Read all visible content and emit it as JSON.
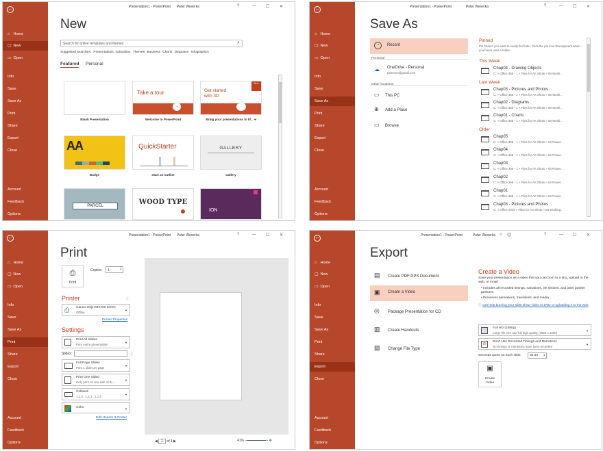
{
  "titlebar": {
    "doc": "Presentation1 - PowerPoint",
    "user": "Peter Weverka",
    "help": "?",
    "min": "—",
    "max": "☐",
    "close": "✕"
  },
  "sidebar": {
    "back": "←",
    "home": "Home",
    "new": "New",
    "open": "Open",
    "info": "Info",
    "save": "Save",
    "saveas": "Save As",
    "print": "Print",
    "share": "Share",
    "export": "Export",
    "close": "Close",
    "account": "Account",
    "feedback": "Feedback",
    "options": "Options"
  },
  "new_panel": {
    "title": "New",
    "search_placeholder": "Search for online templates and themes",
    "suggested": "Suggested searches:",
    "sugg": [
      "Presentations",
      "Education",
      "Themes",
      "Business",
      "Charts",
      "Diagrams",
      "Infographics"
    ],
    "tab_featured": "Featured",
    "tab_personal": "Personal",
    "templates": [
      {
        "name": "Blank Presentation",
        "art": ""
      },
      {
        "name": "Welcome to PowerPoint",
        "art": "Take a tour"
      },
      {
        "name": "Bring your presentations to lif...",
        "art": "Get started with 3D",
        "ribbon": "New"
      },
      {
        "name": "Badge",
        "art": "AA"
      },
      {
        "name": "Start an outline",
        "art": "QuickStarter"
      },
      {
        "name": "Gallery",
        "art": "GALLERY"
      },
      {
        "name": "",
        "art": "PARCEL"
      },
      {
        "name": "",
        "art": "WOOD TYPE"
      },
      {
        "name": "",
        "art": "ION"
      }
    ]
  },
  "saveas_panel": {
    "title": "Save As",
    "recent": "Recent",
    "personal": "Personal",
    "onedrive": "OneDrive - Personal",
    "onedrive_email": "petervev@gmail.com",
    "other": "Other locations",
    "thispc": "This PC",
    "addplace": "Add a Place",
    "browse": "Browse",
    "pinned": "Pinned",
    "pinned_desc": "Pin folders you want to easily find later. Click the pin icon that appears when you hover over a folder.",
    "groups": [
      {
        "label": "This Week",
        "items": [
          {
            "n": "Chap04 - Drawing Objects",
            "p": "C: » Office 365 - 1 » Files for Art Shots » 08 Worki..."
          }
        ]
      },
      {
        "label": "Last Week",
        "items": [
          {
            "n": "Chap03 - Pictures and Photos",
            "p": "C: » Office 365 - 1 » Files for Art Shots » 08 Worki..."
          },
          {
            "n": "Chap02 - Diagrams",
            "p": "C: » Office 365 - 1 » Files for Art Shots » 08 Worki..."
          },
          {
            "n": "Chap01 - Charts",
            "p": "C: » Office 365 - 1 » Files for Art Shots » 08 Worki..."
          }
        ]
      },
      {
        "label": "Older",
        "items": [
          {
            "n": "Chap05",
            "p": "C: » Office 365 - 1 » Files for Art Shots » 04 Power..."
          },
          {
            "n": "Chap04",
            "p": "C: » Office 365 - 1 » Files for Art Shots » 04 Power..."
          },
          {
            "n": "Chap03",
            "p": "C: » Office 365 - 1 » Files for Art Shots » 04 Power..."
          },
          {
            "n": "Chap02",
            "p": "C: » Office 365 - 1 » Files for Art Shots » 04 Power..."
          },
          {
            "n": "Chap01",
            "p": "C: » Office 365 - 1 » Files for Art Shots » 04 Power..."
          },
          {
            "n": "Chap03 - Pictures and Photos",
            "p": "C: » Office 2019 » Files for Art Shots » 08 Working..."
          }
        ]
      }
    ]
  },
  "print_panel": {
    "title": "Print",
    "copies_label": "Copies:",
    "copies": "1",
    "print_btn": "Print",
    "printer_h": "Printer",
    "printer_name": "Canon Inkjet MX700 series",
    "printer_status": "Offline",
    "printer_props": "Printer Properties",
    "settings_h": "Settings",
    "s1": "Print All Slides",
    "s1d": "Print entire presentation",
    "slides_label": "Slides:",
    "s2": "Full Page Slides",
    "s2d": "Print 1 slide per page",
    "s3": "Print One Sided",
    "s3d": "Only print on one side of th...",
    "s4": "Collated",
    "s4d": "1,2,3   1,2,3   1,2,3",
    "s5": "Color",
    "edit_hf": "Edit Header & Footer",
    "page": "1",
    "of": "of 1",
    "zoom": "41%"
  },
  "export_panel": {
    "title": "Export",
    "items": [
      "Create PDF/XPS Document",
      "Create a Video",
      "Package Presentation for CD",
      "Create Handouts",
      "Change File Type"
    ],
    "heading": "Create a Video",
    "desc": "Save your presentation as a video that you can burn to a disc, upload to the web, or email",
    "bullets": [
      "Includes all recorded timings, narrations, ink strokes, and laser pointer gestures",
      "Preserves animations, transitions, and media"
    ],
    "help": "Get help burning your slide show video to DVD or uploading it to the web",
    "q1": "Full HD (1080p)",
    "q1d": "Large file size and full high quality (1920 x 1080)",
    "q2": "Don't Use Recorded Timings and Narrations",
    "q2d": "No timings or narrations have been recorded",
    "secs_label": "Seconds spent on each slide:",
    "secs": "05.00",
    "create": "Create Video"
  },
  "colors": {
    "accent": "#b7472a",
    "accent_dark": "#9a3218",
    "highlight": "#f9d0c0"
  }
}
